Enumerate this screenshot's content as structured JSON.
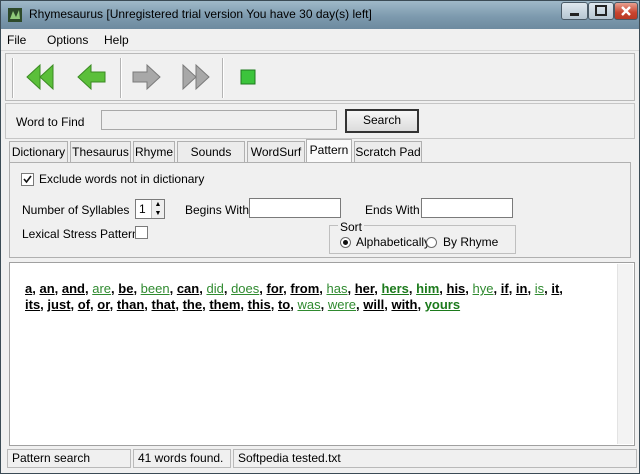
{
  "window": {
    "title": "Rhymesaurus [Unregistered trial version You have 30 day(s) left]"
  },
  "menu": [
    "File",
    "Options",
    "Help"
  ],
  "toolbar": {
    "buttons": [
      {
        "name": "first-button",
        "icon": "double-left-arrow-icon"
      },
      {
        "name": "back-button",
        "icon": "left-arrow-icon"
      },
      {
        "name": "forward-button",
        "icon": "right-arrow-icon"
      },
      {
        "name": "last-button",
        "icon": "double-right-arrow-icon"
      },
      {
        "name": "stop-button",
        "icon": "green-square-icon"
      }
    ]
  },
  "find": {
    "label": "Word to Find",
    "value": "",
    "search_label": "Search"
  },
  "tabs": [
    "Dictionary",
    "Thesaurus",
    "Rhyme",
    "Sounds Like",
    "WordSurf",
    "Pattern",
    "Scratch Pad"
  ],
  "active_tab": "Pattern",
  "pattern": {
    "exclude_label": "Exclude words not in dictionary",
    "exclude_checked": true,
    "syllables_label": "Number of Syllables",
    "syllables_value": "1",
    "begins_label": "Begins With",
    "begins_value": "",
    "ends_label": "Ends With",
    "ends_value": "",
    "stress_label": "Lexical Stress Pattern",
    "stress_checked": false,
    "sort_label": "Sort",
    "sort_options": [
      "Alphabetically",
      "By Rhyme"
    ],
    "sort_selected": "Alphabetically"
  },
  "results": {
    "lines": [
      [
        {
          "t": "a",
          "s": "b"
        },
        {
          "t": "an",
          "s": "b"
        },
        {
          "t": "and",
          "s": "b"
        },
        {
          "t": "are",
          "s": "g"
        },
        {
          "t": "be",
          "s": "b"
        },
        {
          "t": "been",
          "s": "g"
        },
        {
          "t": "can",
          "s": "b"
        },
        {
          "t": "did",
          "s": "g"
        },
        {
          "t": "does",
          "s": "g"
        },
        {
          "t": "for",
          "s": "b"
        },
        {
          "t": "from",
          "s": "b"
        },
        {
          "t": "has",
          "s": "g"
        },
        {
          "t": "her",
          "s": "b"
        },
        {
          "t": "hers",
          "s": "G"
        },
        {
          "t": "him",
          "s": "G"
        },
        {
          "t": "his",
          "s": "b"
        },
        {
          "t": "hye",
          "s": "g"
        },
        {
          "t": "if",
          "s": "b"
        },
        {
          "t": "in",
          "s": "b"
        },
        {
          "t": "is",
          "s": "g"
        },
        {
          "t": "it",
          "s": "b"
        }
      ],
      [
        {
          "t": "its",
          "s": "b"
        },
        {
          "t": "just",
          "s": "b"
        },
        {
          "t": "of",
          "s": "b"
        },
        {
          "t": "or",
          "s": "b"
        },
        {
          "t": "than",
          "s": "b"
        },
        {
          "t": "that",
          "s": "b"
        },
        {
          "t": "the",
          "s": "b"
        },
        {
          "t": "them",
          "s": "b"
        },
        {
          "t": "this",
          "s": "b"
        },
        {
          "t": "to",
          "s": "b"
        },
        {
          "t": "was",
          "s": "g"
        },
        {
          "t": "were",
          "s": "g"
        },
        {
          "t": "will",
          "s": "b"
        },
        {
          "t": "with",
          "s": "b"
        },
        {
          "t": "yours",
          "s": "G"
        }
      ]
    ]
  },
  "status": [
    "Pattern search",
    "41 words found.",
    "Softpedia tested.txt"
  ],
  "colors": {
    "green_word": "#2f8a2f",
    "green_word_bold": "#1c7a1c",
    "arrow_green": "#5bbf3a",
    "arrow_gray": "#9a9a9a"
  }
}
